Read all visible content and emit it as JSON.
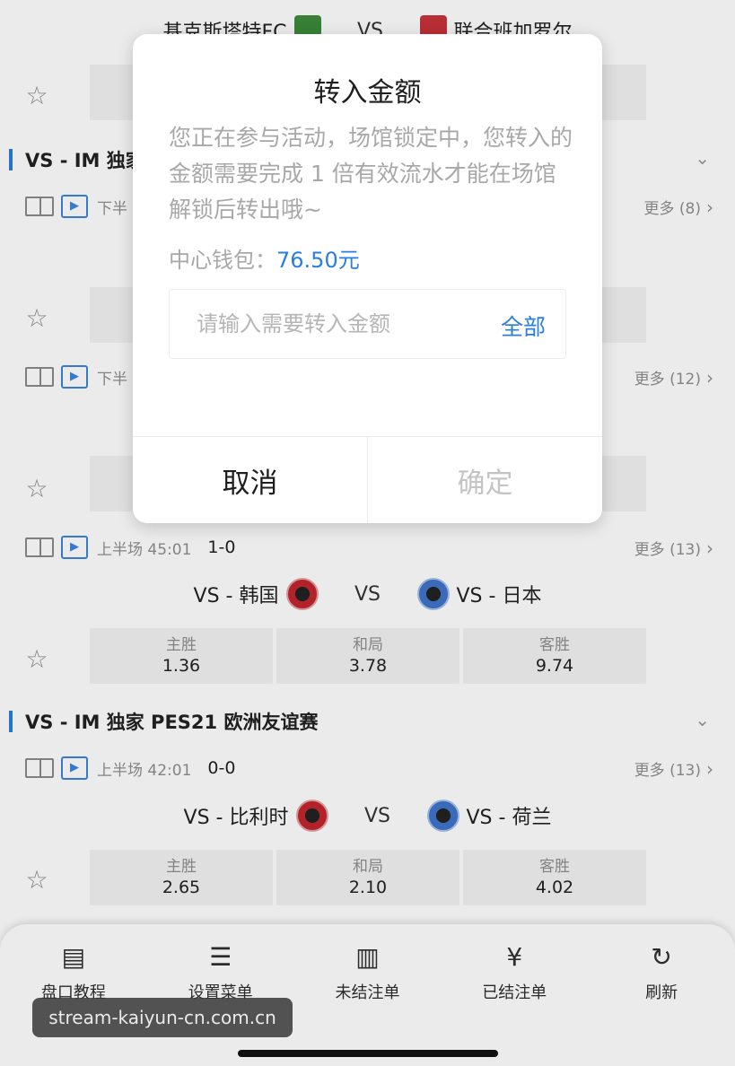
{
  "top_match": {
    "home": "基克斯塔特FC",
    "vs": "VS",
    "away": "联合班加罗尔"
  },
  "leagues": [
    {
      "name": "VS - IM 独家"
    },
    {
      "name": "VS - IM 独家 PES21 欧洲友谊赛"
    }
  ],
  "matches": [
    {
      "period": "下半",
      "score": "",
      "more": "更多 (8)"
    },
    {
      "period": "下半",
      "score": "",
      "more": "更多 (12)"
    },
    {
      "period": "上半场 45:01",
      "score": "1-0",
      "more": "更多 (13)",
      "home": "VS - 韩国",
      "vs": "VS",
      "away": "VS - 日本",
      "odds": [
        {
          "label": "主胜",
          "value": "1.36"
        },
        {
          "label": "和局",
          "value": "3.78"
        },
        {
          "label": "客胜",
          "value": "9.74"
        }
      ]
    },
    {
      "period": "上半场 42:01",
      "score": "0-0",
      "more": "更多 (13)",
      "home": "VS - 比利时",
      "vs": "VS",
      "away": "VS - 荷兰",
      "odds": [
        {
          "label": "主胜",
          "value": "2.65"
        },
        {
          "label": "和局",
          "value": "2.10"
        },
        {
          "label": "客胜",
          "value": "4.02"
        }
      ]
    }
  ],
  "tv_icon_text": "▶",
  "star_icon": "☆",
  "chevron_right": "›",
  "chevron_down": "⌄",
  "bottom_bar": [
    {
      "label": "盘口教程",
      "icon": "document-icon",
      "glyph": "▤"
    },
    {
      "label": "设置菜单",
      "icon": "sliders-icon",
      "glyph": "☰"
    },
    {
      "label": "未结注单",
      "icon": "clipboard-icon",
      "glyph": "▥"
    },
    {
      "label": "已结注单",
      "icon": "yen-clipboard-icon",
      "glyph": "¥"
    },
    {
      "label": "刷新",
      "icon": "refresh-icon",
      "glyph": "↻"
    }
  ],
  "watermark": "stream-kaiyun-cn.com.cn",
  "dialog": {
    "title": "转入金额",
    "message": "您正在参与活动，场馆锁定中，您转入的金额需要完成 1 倍有效流水才能在场馆解锁后转出哦~",
    "wallet_label": "中心钱包：",
    "wallet_amount": "76.50元",
    "input_placeholder": "请输入需要转入金额",
    "all_label": "全部",
    "cancel_label": "取消",
    "confirm_label": "确定"
  },
  "colors": {
    "accent": "#2a7de1",
    "disabled": "#c4c4c4"
  }
}
